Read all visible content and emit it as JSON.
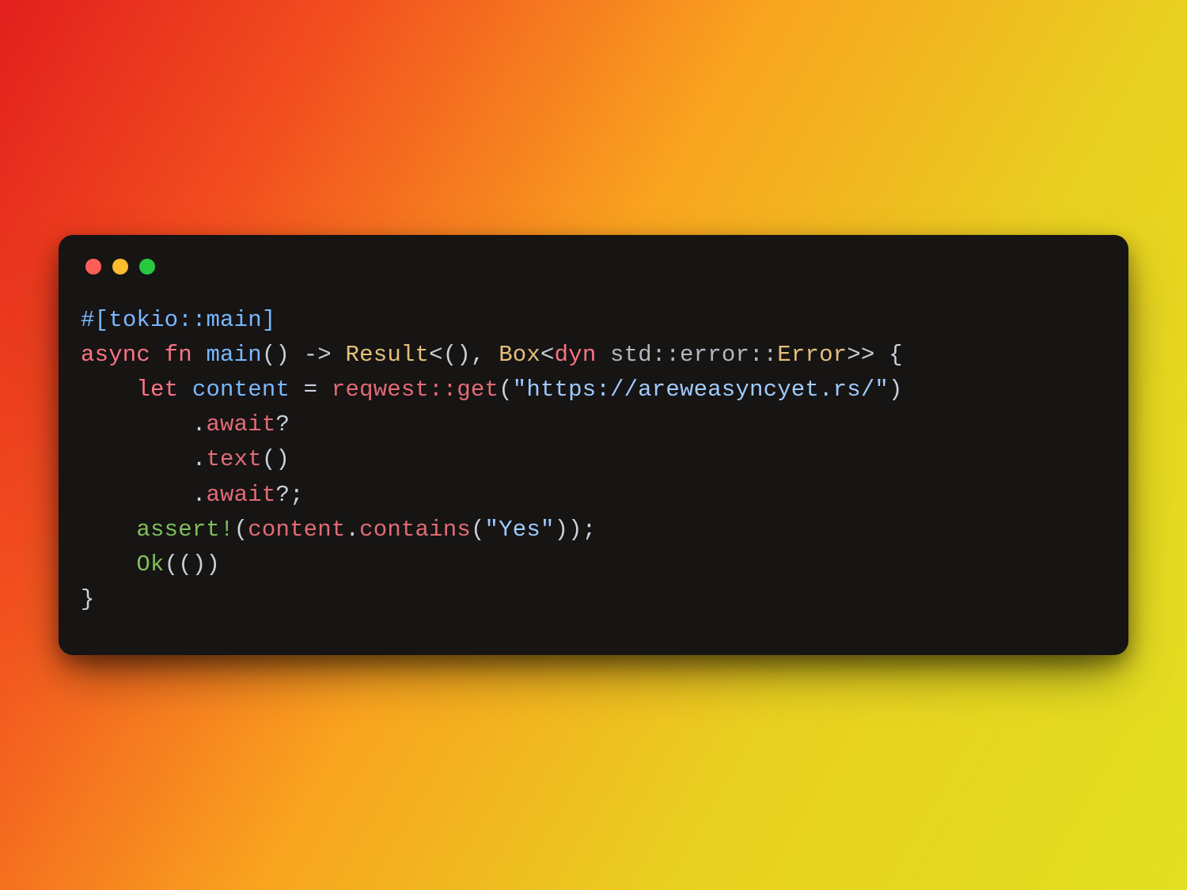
{
  "colors": {
    "bg_gradient_from": "#e21f1d",
    "bg_gradient_to": "#e2e021",
    "window_bg": "#171414",
    "traffic_red": "#ff5f57",
    "traffic_yellow": "#febc2e",
    "traffic_green": "#28c840"
  },
  "code": {
    "language": "rust",
    "plain": "#[tokio::main]\nasync fn main() -> Result<(), Box<dyn std::error::Error>> {\n    let content = reqwest::get(\"https://areweasyncyet.rs/\")\n        .await?\n        .text()\n        .await?;\n    assert!(content.contains(\"Yes\"));\n    Ok(())\n}",
    "t": {
      "attr_open": "#[",
      "attr_path": "tokio::main",
      "attr_close": "]",
      "kw_async": "async",
      "kw_fn": "fn",
      "fn_name": "main",
      "paren_empty": "()",
      "arrow": " -> ",
      "type_result": "Result",
      "lt": "<",
      "unit": "()",
      "comma": ", ",
      "type_box": "Box",
      "kw_dyn": "dyn",
      "ns_std_error": "std::error::",
      "type_error": "Error",
      "gt2": ">>",
      "brace_open": " {",
      "indent1": "    ",
      "indent2": "        ",
      "kw_let": "let",
      "var_content": "content",
      "eq": " = ",
      "ns_reqwest": "reqwest::",
      "fn_get": "get",
      "paren_open": "(",
      "str_url": "\"https://areweasyncyet.rs/\"",
      "paren_close": ")",
      "dot": ".",
      "m_await": "await",
      "qmark": "?",
      "m_text": "text",
      "semicolon": ";",
      "macro_assert": "assert!",
      "m_contains": "contains",
      "str_yes": "\"Yes\"",
      "enum_ok": "Ok",
      "dbl_paren": "(())",
      "brace_close": "}"
    }
  }
}
